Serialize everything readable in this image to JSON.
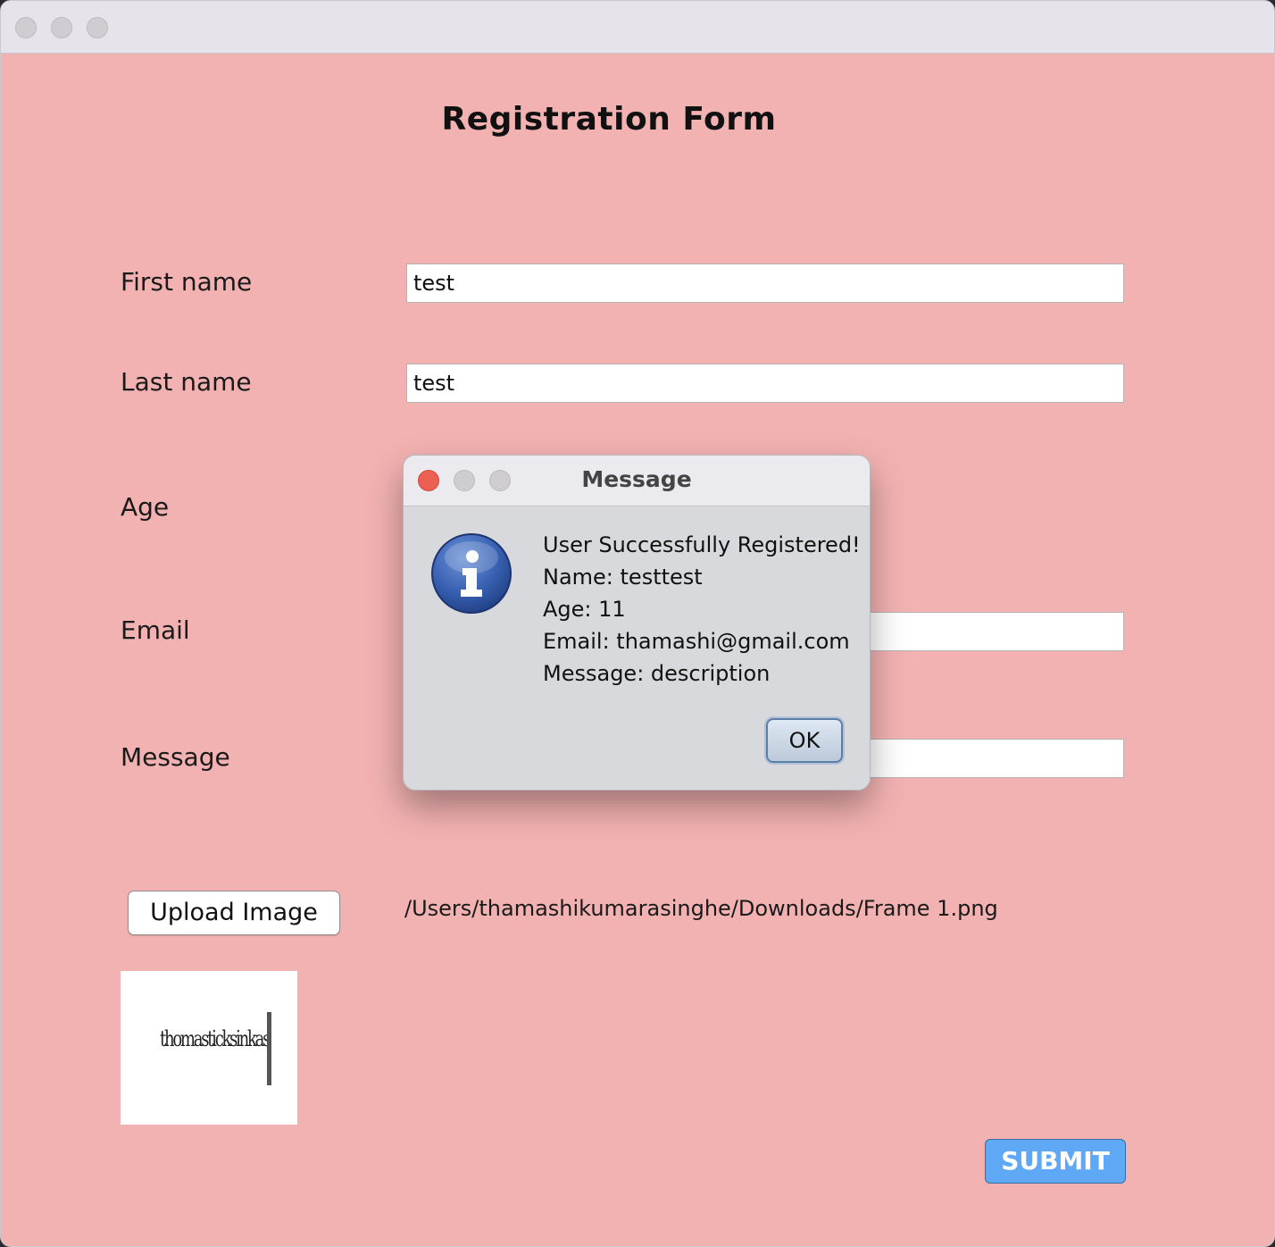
{
  "window": {
    "title": ""
  },
  "form": {
    "title": "Registration Form",
    "fields": {
      "first_name": {
        "label": "First name",
        "value": "test"
      },
      "last_name": {
        "label": "Last name",
        "value": "test"
      },
      "age": {
        "label": "Age"
      },
      "email": {
        "label": "Email",
        "value": ""
      },
      "message": {
        "label": "Message",
        "value": ""
      }
    },
    "upload_button": "Upload Image",
    "file_path": "/Users/thamashikumarasinghe/Downloads/Frame 1.png",
    "preview_text": "thomasticksinkas",
    "submit_button": "SUBMIT"
  },
  "dialog": {
    "title": "Message",
    "icon": "info-icon",
    "lines": [
      "User Successfully Registered!",
      "Name: testtest",
      "Age: 11",
      "Email: thamashi@gmail.com",
      "Message: description"
    ],
    "ok_button": "OK"
  },
  "colors": {
    "form_background": "#f3b2b2",
    "submit_button": "#5fa8f5",
    "dialog_background": "#d8d9dd",
    "close_light": "#ec5f53"
  }
}
